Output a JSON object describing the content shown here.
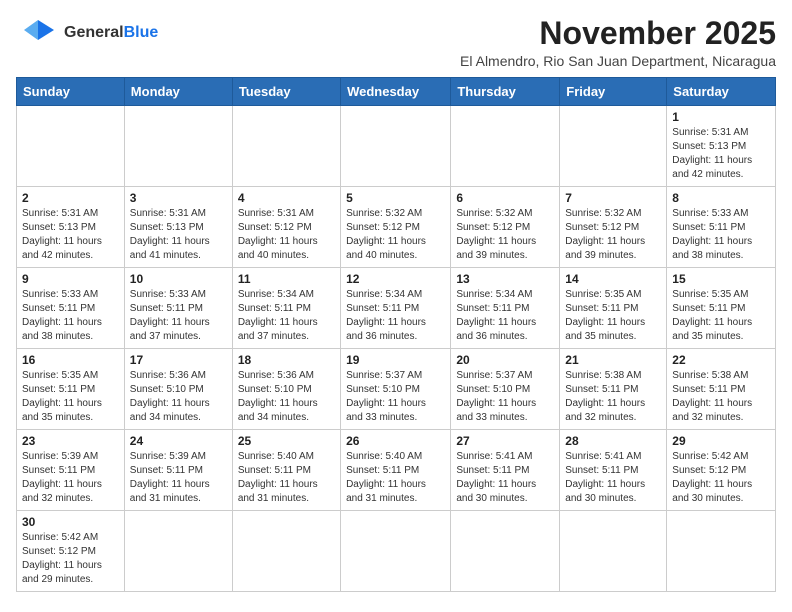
{
  "header": {
    "logo_general": "General",
    "logo_blue": "Blue",
    "month_title": "November 2025",
    "location": "El Almendro, Rio San Juan Department, Nicaragua"
  },
  "days_of_week": [
    "Sunday",
    "Monday",
    "Tuesday",
    "Wednesday",
    "Thursday",
    "Friday",
    "Saturday"
  ],
  "weeks": [
    [
      {
        "day": "",
        "info": ""
      },
      {
        "day": "",
        "info": ""
      },
      {
        "day": "",
        "info": ""
      },
      {
        "day": "",
        "info": ""
      },
      {
        "day": "",
        "info": ""
      },
      {
        "day": "",
        "info": ""
      },
      {
        "day": "1",
        "info": "Sunrise: 5:31 AM\nSunset: 5:13 PM\nDaylight: 11 hours\nand 42 minutes."
      }
    ],
    [
      {
        "day": "2",
        "info": "Sunrise: 5:31 AM\nSunset: 5:13 PM\nDaylight: 11 hours\nand 42 minutes."
      },
      {
        "day": "3",
        "info": "Sunrise: 5:31 AM\nSunset: 5:13 PM\nDaylight: 11 hours\nand 41 minutes."
      },
      {
        "day": "4",
        "info": "Sunrise: 5:31 AM\nSunset: 5:12 PM\nDaylight: 11 hours\nand 40 minutes."
      },
      {
        "day": "5",
        "info": "Sunrise: 5:32 AM\nSunset: 5:12 PM\nDaylight: 11 hours\nand 40 minutes."
      },
      {
        "day": "6",
        "info": "Sunrise: 5:32 AM\nSunset: 5:12 PM\nDaylight: 11 hours\nand 39 minutes."
      },
      {
        "day": "7",
        "info": "Sunrise: 5:32 AM\nSunset: 5:12 PM\nDaylight: 11 hours\nand 39 minutes."
      },
      {
        "day": "8",
        "info": "Sunrise: 5:33 AM\nSunset: 5:11 PM\nDaylight: 11 hours\nand 38 minutes."
      }
    ],
    [
      {
        "day": "9",
        "info": "Sunrise: 5:33 AM\nSunset: 5:11 PM\nDaylight: 11 hours\nand 38 minutes."
      },
      {
        "day": "10",
        "info": "Sunrise: 5:33 AM\nSunset: 5:11 PM\nDaylight: 11 hours\nand 37 minutes."
      },
      {
        "day": "11",
        "info": "Sunrise: 5:34 AM\nSunset: 5:11 PM\nDaylight: 11 hours\nand 37 minutes."
      },
      {
        "day": "12",
        "info": "Sunrise: 5:34 AM\nSunset: 5:11 PM\nDaylight: 11 hours\nand 36 minutes."
      },
      {
        "day": "13",
        "info": "Sunrise: 5:34 AM\nSunset: 5:11 PM\nDaylight: 11 hours\nand 36 minutes."
      },
      {
        "day": "14",
        "info": "Sunrise: 5:35 AM\nSunset: 5:11 PM\nDaylight: 11 hours\nand 35 minutes."
      },
      {
        "day": "15",
        "info": "Sunrise: 5:35 AM\nSunset: 5:11 PM\nDaylight: 11 hours\nand 35 minutes."
      }
    ],
    [
      {
        "day": "16",
        "info": "Sunrise: 5:35 AM\nSunset: 5:11 PM\nDaylight: 11 hours\nand 35 minutes."
      },
      {
        "day": "17",
        "info": "Sunrise: 5:36 AM\nSunset: 5:10 PM\nDaylight: 11 hours\nand 34 minutes."
      },
      {
        "day": "18",
        "info": "Sunrise: 5:36 AM\nSunset: 5:10 PM\nDaylight: 11 hours\nand 34 minutes."
      },
      {
        "day": "19",
        "info": "Sunrise: 5:37 AM\nSunset: 5:10 PM\nDaylight: 11 hours\nand 33 minutes."
      },
      {
        "day": "20",
        "info": "Sunrise: 5:37 AM\nSunset: 5:10 PM\nDaylight: 11 hours\nand 33 minutes."
      },
      {
        "day": "21",
        "info": "Sunrise: 5:38 AM\nSunset: 5:11 PM\nDaylight: 11 hours\nand 32 minutes."
      },
      {
        "day": "22",
        "info": "Sunrise: 5:38 AM\nSunset: 5:11 PM\nDaylight: 11 hours\nand 32 minutes."
      }
    ],
    [
      {
        "day": "23",
        "info": "Sunrise: 5:39 AM\nSunset: 5:11 PM\nDaylight: 11 hours\nand 32 minutes."
      },
      {
        "day": "24",
        "info": "Sunrise: 5:39 AM\nSunset: 5:11 PM\nDaylight: 11 hours\nand 31 minutes."
      },
      {
        "day": "25",
        "info": "Sunrise: 5:40 AM\nSunset: 5:11 PM\nDaylight: 11 hours\nand 31 minutes."
      },
      {
        "day": "26",
        "info": "Sunrise: 5:40 AM\nSunset: 5:11 PM\nDaylight: 11 hours\nand 31 minutes."
      },
      {
        "day": "27",
        "info": "Sunrise: 5:41 AM\nSunset: 5:11 PM\nDaylight: 11 hours\nand 30 minutes."
      },
      {
        "day": "28",
        "info": "Sunrise: 5:41 AM\nSunset: 5:11 PM\nDaylight: 11 hours\nand 30 minutes."
      },
      {
        "day": "29",
        "info": "Sunrise: 5:42 AM\nSunset: 5:12 PM\nDaylight: 11 hours\nand 30 minutes."
      }
    ],
    [
      {
        "day": "30",
        "info": "Sunrise: 5:42 AM\nSunset: 5:12 PM\nDaylight: 11 hours\nand 29 minutes."
      },
      {
        "day": "",
        "info": ""
      },
      {
        "day": "",
        "info": ""
      },
      {
        "day": "",
        "info": ""
      },
      {
        "day": "",
        "info": ""
      },
      {
        "day": "",
        "info": ""
      },
      {
        "day": "",
        "info": ""
      }
    ]
  ]
}
